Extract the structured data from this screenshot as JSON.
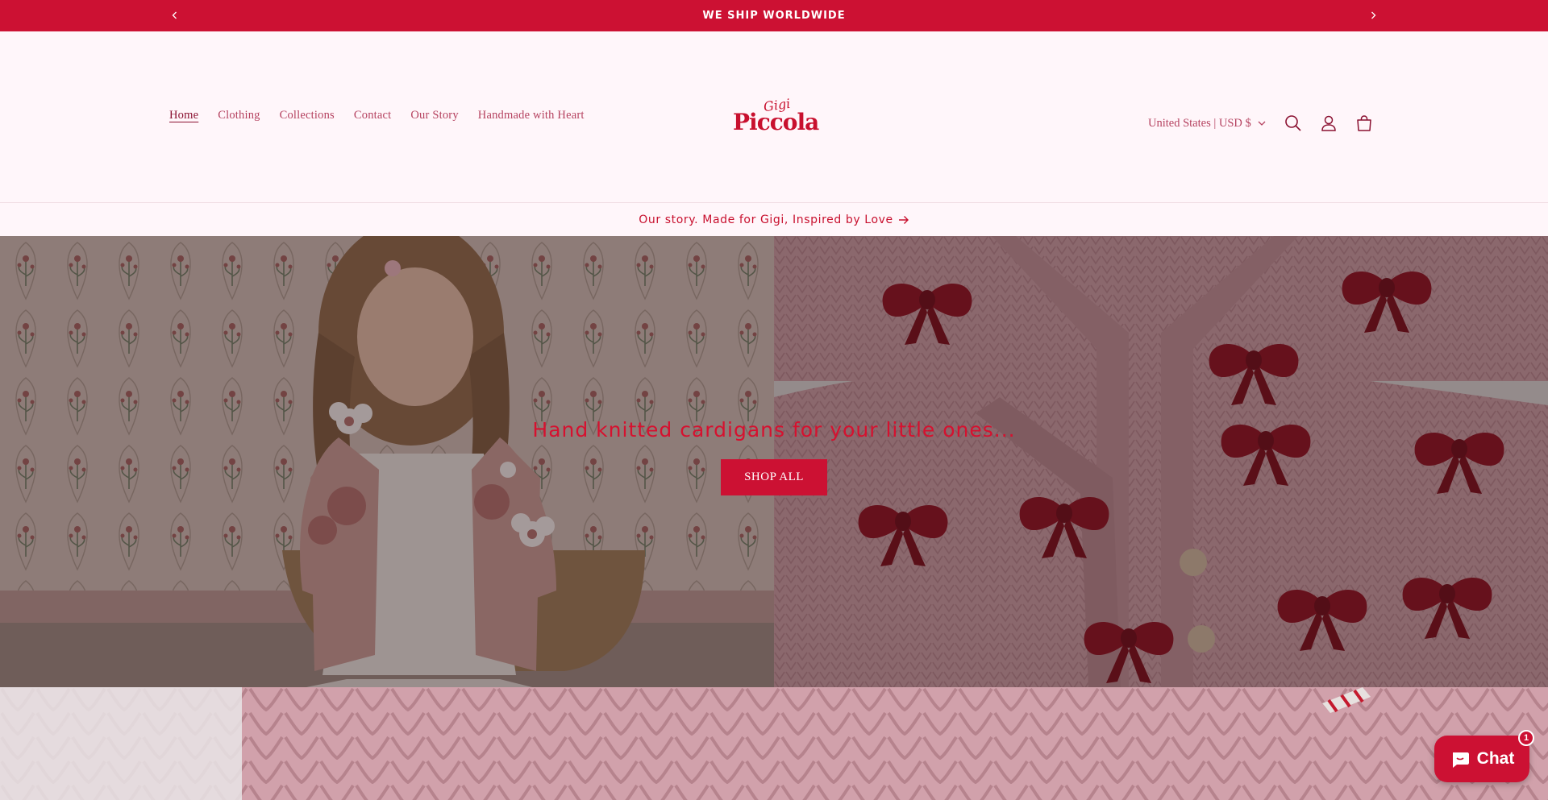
{
  "announcement": {
    "text": "WE SHIP WORLDWIDE",
    "prev_icon": "chevron-left-icon",
    "next_icon": "chevron-right-icon"
  },
  "nav": {
    "items": [
      {
        "label": "Home",
        "active": true
      },
      {
        "label": "Clothing"
      },
      {
        "label": "Collections"
      },
      {
        "label": "Contact"
      },
      {
        "label": "Our Story"
      },
      {
        "label": "Handmade with Heart"
      }
    ]
  },
  "logo": {
    "script": "Gigi",
    "main": "Piccola"
  },
  "header_right": {
    "locale": "United States | USD $",
    "icons": [
      "search-icon",
      "account-icon",
      "cart-icon"
    ]
  },
  "story_link": {
    "label": "Our story. Made for Gigi, Inspired by Love"
  },
  "hero": {
    "title": "Hand knitted cardigans for your little ones...",
    "button": "SHOP ALL"
  },
  "chat": {
    "label": "Chat",
    "badge": "1"
  },
  "colors": {
    "brand": "#cc1133",
    "background": "#fff6fa",
    "nav_text": "#b5415f"
  }
}
